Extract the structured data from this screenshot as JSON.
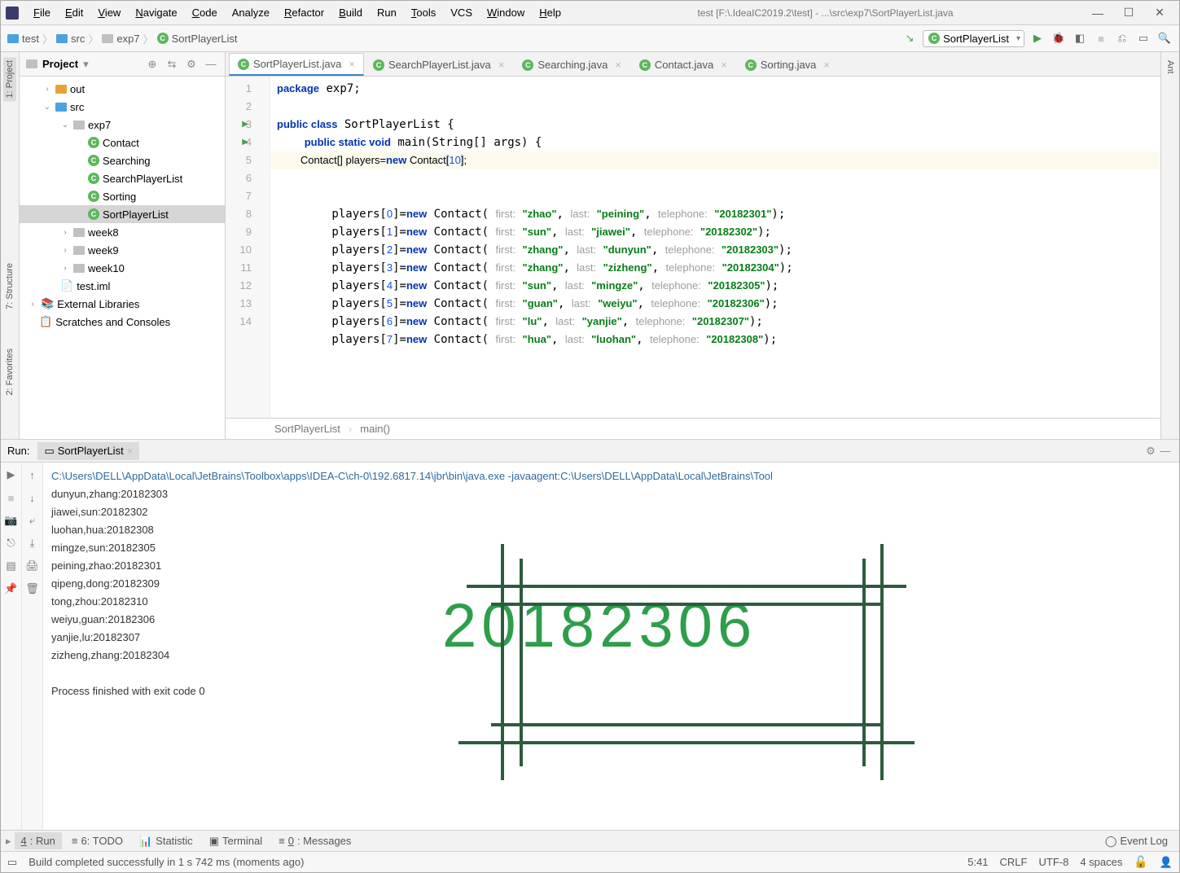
{
  "window": {
    "title": "test [F:\\.IdeaIC2019.2\\test] - ...\\src\\exp7\\SortPlayerList.java"
  },
  "menu": {
    "file": "File",
    "edit": "Edit",
    "view": "View",
    "navigate": "Navigate",
    "code": "Code",
    "analyze": "Analyze",
    "refactor": "Refactor",
    "build": "Build",
    "run": "Run",
    "tools": "Tools",
    "vcs": "VCS",
    "window": "Window",
    "help": "Help"
  },
  "breadcrumb": {
    "root": "test",
    "p1": "src",
    "p2": "exp7",
    "file": "SortPlayerList"
  },
  "runConfig": "SortPlayerList",
  "project": {
    "paneTitle": "Project",
    "tree": {
      "out": "out",
      "src": "src",
      "exp7": "exp7",
      "contact": "Contact",
      "searching": "Searching",
      "searchPlayerList": "SearchPlayerList",
      "sorting": "Sorting",
      "sortPlayerList": "SortPlayerList",
      "week8": "week8",
      "week9": "week9",
      "week10": "week10",
      "iml": "test.iml",
      "ext": "External Libraries",
      "scratches": "Scratches and Consoles"
    }
  },
  "tabs": {
    "t1": "SortPlayerList.java",
    "t2": "SearchPlayerList.java",
    "t3": "Searching.java",
    "t4": "Contact.java",
    "t5": "Sorting.java"
  },
  "code": {
    "lines": [
      "1",
      "2",
      "3",
      "4",
      "5",
      "6",
      "7",
      "8",
      "9",
      "10",
      "11",
      "12",
      "13",
      "14"
    ],
    "l1_a": "package",
    "l1_b": " exp7;",
    "l3_a": "public class",
    "l3_b": " SortPlayerList {",
    "l4_a": "public static void",
    "l4_b": " main(String[] args) {",
    "l5_a": "Contact[] players=",
    "l5_b": "new",
    "l5_c": " Contact",
    "l5_d": "[",
    "l5_e": "10",
    "l5_f": "]",
    "rows": [
      {
        "idx": "0",
        "first": "zhao",
        "last": "peining",
        "tel": "20182301"
      },
      {
        "idx": "1",
        "first": "sun",
        "last": "jiawei",
        "tel": "20182302"
      },
      {
        "idx": "2",
        "first": "zhang",
        "last": "dunyun",
        "tel": "20182303"
      },
      {
        "idx": "3",
        "first": "zhang",
        "last": "zizheng",
        "tel": "20182304"
      },
      {
        "idx": "4",
        "first": "sun",
        "last": "mingze",
        "tel": "20182305"
      },
      {
        "idx": "5",
        "first": "guan",
        "last": "weiyu",
        "tel": "20182306"
      },
      {
        "idx": "6",
        "first": "lu",
        "last": "yanjie",
        "tel": "20182307"
      },
      {
        "idx": "7",
        "first": "hua",
        "last": "luohan",
        "tel": "20182308"
      }
    ],
    "crumb1": "SortPlayerList",
    "crumb2": "main()"
  },
  "console": {
    "cmd": "C:\\Users\\DELL\\AppData\\Local\\JetBrains\\Toolbox\\apps\\IDEA-C\\ch-0\\192.6817.14\\jbr\\bin\\java.exe -javaagent:C:\\Users\\DELL\\AppData\\Local\\JetBrains\\Tool",
    "out": [
      "dunyun,zhang:20182303",
      "jiawei,sun:20182302",
      "luohan,hua:20182308",
      "mingze,sun:20182305",
      "peining,zhao:20182301",
      "qipeng,dong:20182309",
      "tong,zhou:20182310",
      "weiyu,guan:20182306",
      "yanjie,lu:20182307",
      "zizheng,zhang:20182304"
    ],
    "exit": "Process finished with exit code 0",
    "watermark": "20182306"
  },
  "runTab": {
    "label": "Run:",
    "name": "SortPlayerList"
  },
  "bottom": {
    "run": "4: Run",
    "todo": "6: TODO",
    "stat": "Statistic",
    "term": "Terminal",
    "msg": "0: Messages",
    "event": "Event Log"
  },
  "status": {
    "msg": "Build completed successfully in 1 s 742 ms (moments ago)",
    "pos": "5:41",
    "eol": "CRLF",
    "enc": "UTF-8",
    "indent": "4 spaces"
  },
  "sideTabs": {
    "project": "1: Project",
    "structure": "7: Structure",
    "fav": "2: Favorites",
    "ant": "Ant"
  }
}
